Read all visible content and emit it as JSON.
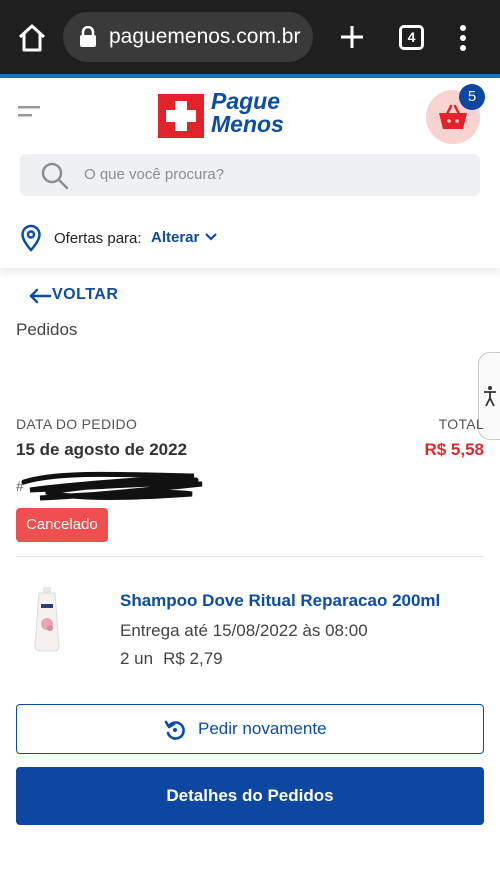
{
  "browser": {
    "url": "paguemenos.com.br",
    "tab_count": "4"
  },
  "header": {
    "logo_line1": "Pague",
    "logo_line2": "Menos",
    "cart_count": "5",
    "search_placeholder": "O que você procura?",
    "offers_label": "Ofertas para:",
    "offers_change": "Alterar"
  },
  "page": {
    "back_label": "VOLTAR",
    "title": "Pedidos"
  },
  "order": {
    "date_label": "DATA DO PEDIDO",
    "date_value": "15 de agosto de 2022",
    "total_label": "TOTAL",
    "total_value": "R$ 5,58",
    "order_number_prefix": "#",
    "status": "Cancelado"
  },
  "item": {
    "name": "Shampoo Dove Ritual Reparacao 200ml",
    "delivery": "Entrega até 15/08/2022 às 08:00",
    "quantity": "2 un",
    "unit_price": "R$ 2,79"
  },
  "actions": {
    "reorder_label": "Pedir novamente",
    "details_label": "Detalhes do Pedidos"
  },
  "colors": {
    "brand_blue": "#0d4da1",
    "brand_red": "#e2232a",
    "status_red": "#ef4f4f",
    "price_red": "#e0282f"
  }
}
